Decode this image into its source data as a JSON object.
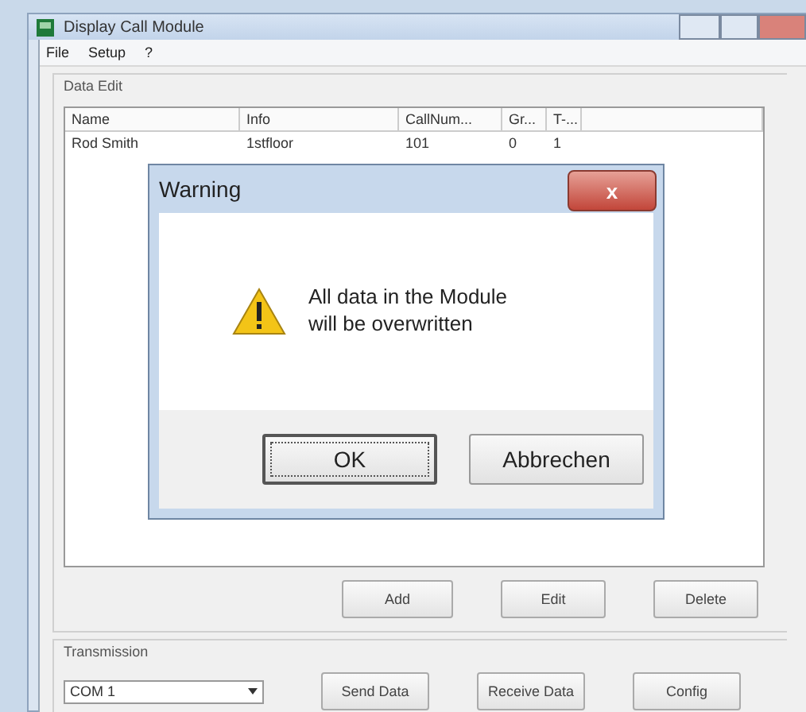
{
  "window": {
    "title": "Display Call Module"
  },
  "menu": [
    "File",
    "Setup",
    "?"
  ],
  "data_edit": {
    "title": "Data Edit",
    "columns": [
      "Name",
      "Info",
      "CallNum...",
      "Gr...",
      "T-..."
    ],
    "rows": [
      [
        "Rod Smith",
        "1stfloor",
        "101",
        "0",
        "1"
      ]
    ],
    "buttons": [
      "Add",
      "Edit",
      "Delete"
    ]
  },
  "transmission": {
    "title": "Transmission",
    "port": "COM 1",
    "buttons": [
      "Send Data",
      "Receive Data",
      "Config"
    ]
  },
  "dialog": {
    "title": "Warning",
    "close": "x",
    "message": "All data in the Module will be overwritten",
    "buttons": [
      {
        "label": "OK",
        "selected": true
      },
      {
        "label": "Abbrechen",
        "selected": false
      }
    ]
  }
}
